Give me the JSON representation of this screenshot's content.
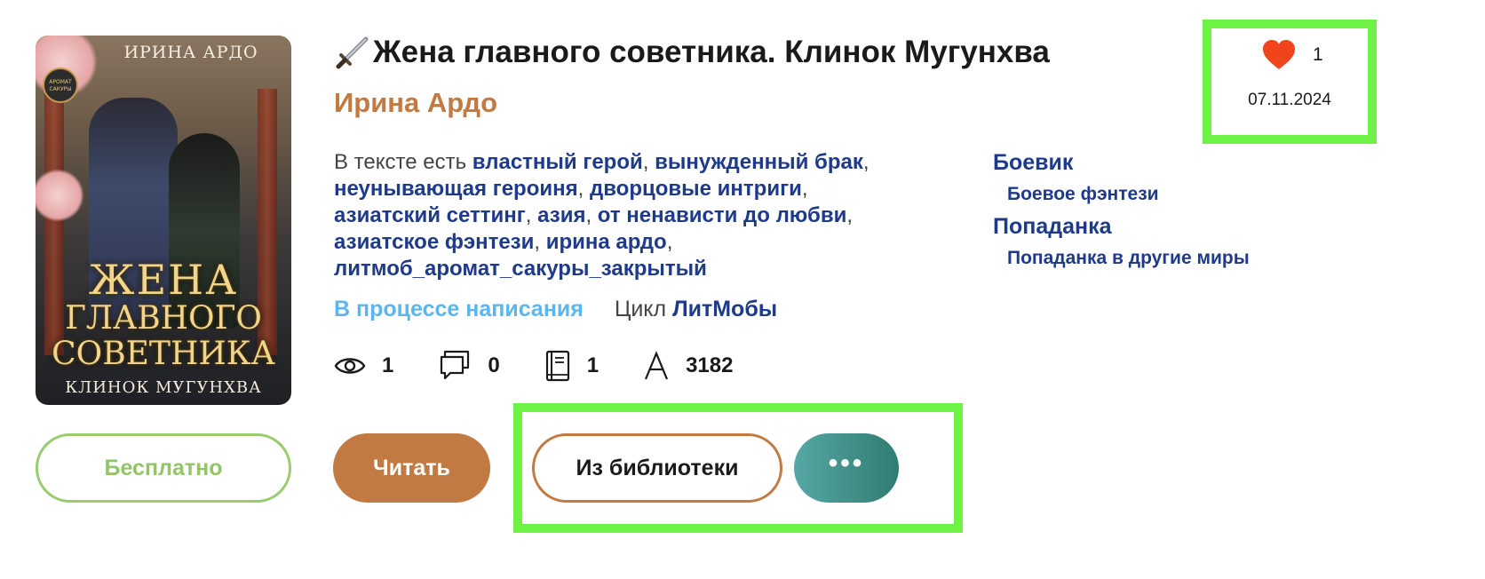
{
  "book": {
    "title": "Жена главного советника. Клинок Мугунхва",
    "author": "Ирина Ардо",
    "tags_prefix": "В тексте есть",
    "tags": [
      "властный герой",
      "вынужденный брак",
      "неунывающая героиня",
      "дворцовые интриги",
      "азиатский сеттинг",
      "азия",
      "от ненависти до любви",
      "азиатское фэнтези",
      "ирина ардо",
      "литмоб_аромат_сакуры_закрытый"
    ],
    "genres": [
      {
        "main": "Боевик",
        "sub": "Боевое фэнтези"
      },
      {
        "main": "Попаданка",
        "sub": "Попаданка в другие миры"
      }
    ],
    "status": "В процессе написания",
    "cycle_label": "Цикл",
    "cycle": "ЛитМобы",
    "stats": {
      "views": "1",
      "comments": "0",
      "in_libraries": "1",
      "chars": "3182"
    },
    "likes": "1",
    "date": "07.11.2024"
  },
  "cover": {
    "author_text": "ИРИНА АРДО",
    "badge_text": "АРОМАТ САКУРЫ",
    "title_line1": "ЖЕНА",
    "title_line2": "ГЛАВНОГО",
    "title_line3": "СОВЕТНИКА",
    "subtitle": "КЛИНОК МУГУНХВА"
  },
  "buttons": {
    "free": "Бесплатно",
    "read": "Читать",
    "library": "Из библиотеки",
    "more": "•••"
  },
  "icons": {
    "title_icon": "sword-icon",
    "views": "eye-icon",
    "comments": "comment-icon",
    "library": "book-icon",
    "chars": "letter-a-icon",
    "like": "heart-icon"
  },
  "colors": {
    "accent": "#c07a42",
    "link": "#1e3a8a",
    "status": "#5bb6ef",
    "free": "#93c567",
    "highlight": "#6ef246",
    "heart": "#f0441c"
  }
}
